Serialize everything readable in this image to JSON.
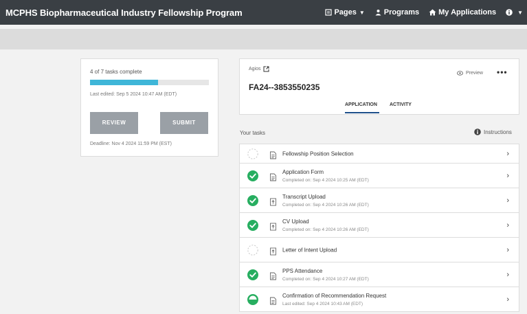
{
  "header": {
    "title": "MCPHS Biopharmaceutical Industry Fellowship Program",
    "nav": {
      "pages": "Pages",
      "programs": "Programs",
      "my_applications": "My Applications"
    }
  },
  "summary": {
    "tasks_complete": "4 of 7 tasks complete",
    "progress_fraction": 0.57,
    "last_edited": "Last edited: Sep 5 2024 10:47 AM (EDT)",
    "review_label": "REVIEW",
    "submit_label": "SUBMIT",
    "deadline": "Deadline: Nov 4 2024 11:59 PM (EST)"
  },
  "application": {
    "organization": "Agios",
    "preview_label": "Preview",
    "more_label": "•••",
    "id": "FA24--3853550235",
    "tabs": {
      "application": "APPLICATION",
      "activity": "ACTIVITY"
    }
  },
  "tasks_header": {
    "title": "Your tasks",
    "instructions": "Instructions"
  },
  "tasks": [
    {
      "name": "Fellowship Position Selection",
      "sub": "",
      "status": "incomplete",
      "icon": "document-icon"
    },
    {
      "name": "Application Form",
      "sub": "Completed on: Sep 4 2024 10:25 AM (EDT)",
      "status": "complete",
      "icon": "document-icon"
    },
    {
      "name": "Transcript Upload",
      "sub": "Completed on: Sep 4 2024 10:26 AM (EDT)",
      "status": "complete",
      "icon": "upload-icon"
    },
    {
      "name": "CV Upload",
      "sub": "Completed on: Sep 4 2024 10:26 AM (EDT)",
      "status": "complete",
      "icon": "upload-icon"
    },
    {
      "name": "Letter of Intent Upload",
      "sub": "",
      "status": "incomplete",
      "icon": "upload-icon"
    },
    {
      "name": "PPS Attendance",
      "sub": "Completed on: Sep 4 2024 10:27 AM (EDT)",
      "status": "complete",
      "icon": "document-icon"
    },
    {
      "name": "Confirmation of Recommendation Request",
      "sub": "Last edited: Sep 4 2024 10:43 AM (EDT)",
      "status": "in-progress",
      "icon": "document-icon"
    }
  ]
}
